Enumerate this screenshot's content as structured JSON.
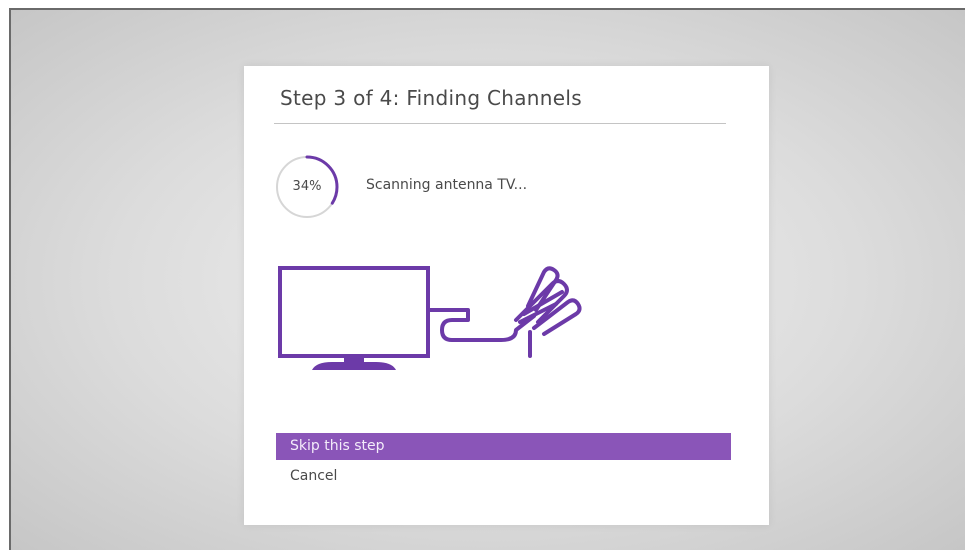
{
  "dialog": {
    "title": "Step 3 of 4: Finding Channels",
    "progress": {
      "percent_label": "34%",
      "value": 0.34
    },
    "status": "Scanning antenna TV...",
    "illustration_icon": "tv-antenna-icon",
    "menu": [
      {
        "label": "Skip this step",
        "selected": true
      },
      {
        "label": "Cancel",
        "selected": false
      }
    ]
  },
  "colors": {
    "accent": "#6c3aa8",
    "highlight": "#8a55b8",
    "ring_track": "#d6d6d6",
    "background": "#d8d8d8"
  }
}
